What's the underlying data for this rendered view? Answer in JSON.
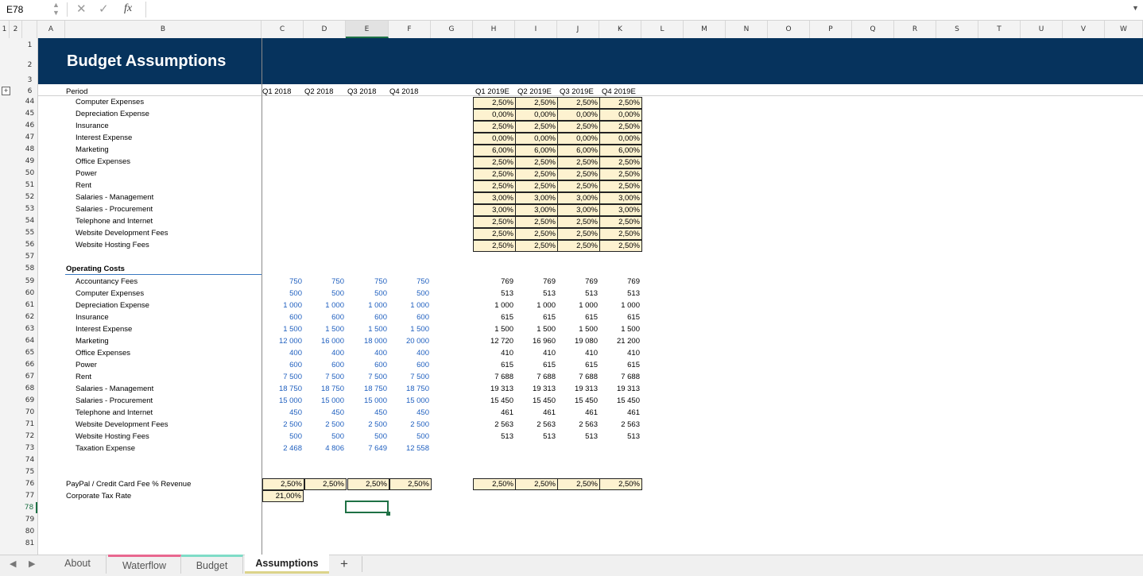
{
  "formula_bar": {
    "name_box": "E78",
    "fx_label": "fx",
    "formula": ""
  },
  "outline_levels": [
    "1",
    "2"
  ],
  "columns": [
    "A",
    "B",
    "C",
    "D",
    "E",
    "F",
    "G",
    "H",
    "I",
    "J",
    "K",
    "L",
    "M",
    "N",
    "O",
    "P",
    "Q",
    "R",
    "S",
    "T",
    "U",
    "V",
    "W"
  ],
  "rows": [
    "1",
    "2",
    "3",
    "6",
    "44",
    "45",
    "46",
    "47",
    "48",
    "49",
    "50",
    "51",
    "52",
    "53",
    "54",
    "55",
    "56",
    "57",
    "58",
    "59",
    "60",
    "61",
    "62",
    "63",
    "64",
    "65",
    "66",
    "67",
    "68",
    "69",
    "70",
    "71",
    "72",
    "73",
    "74",
    "75",
    "76",
    "77",
    "78",
    "79",
    "80",
    "81"
  ],
  "title": "Budget Assumptions",
  "period_label": "Period",
  "periods_2018": [
    "Q1 2018",
    "Q2 2018",
    "Q3 2018",
    "Q4 2018"
  ],
  "periods_2019": [
    "Q1 2019E",
    "Q2 2019E",
    "Q3 2019E",
    "Q4 2019E"
  ],
  "growth_labels": [
    "Computer Expenses",
    "Depreciation Expense",
    "Insurance",
    "Interest Expense",
    "Marketing",
    "Office Expenses",
    "Power",
    "Rent",
    "Salaries - Management",
    "Salaries - Procurement",
    "Telephone and Internet",
    "Website Development Fees",
    "Website Hosting Fees"
  ],
  "growth_rates": [
    "2,50%",
    "0,00%",
    "2,50%",
    "0,00%",
    "6,00%",
    "2,50%",
    "2,50%",
    "2,50%",
    "3,00%",
    "3,00%",
    "2,50%",
    "2,50%",
    "2,50%"
  ],
  "operating_title": "Operating Costs",
  "operating": [
    {
      "label": "Accountancy Fees",
      "q2018": [
        "750",
        "750",
        "750",
        "750"
      ],
      "q2019": [
        "769",
        "769",
        "769",
        "769"
      ]
    },
    {
      "label": "Computer Expenses",
      "q2018": [
        "500",
        "500",
        "500",
        "500"
      ],
      "q2019": [
        "513",
        "513",
        "513",
        "513"
      ]
    },
    {
      "label": "Depreciation Expense",
      "q2018": [
        "1 000",
        "1 000",
        "1 000",
        "1 000"
      ],
      "q2019": [
        "1 000",
        "1 000",
        "1 000",
        "1 000"
      ]
    },
    {
      "label": "Insurance",
      "q2018": [
        "600",
        "600",
        "600",
        "600"
      ],
      "q2019": [
        "615",
        "615",
        "615",
        "615"
      ]
    },
    {
      "label": "Interest Expense",
      "q2018": [
        "1 500",
        "1 500",
        "1 500",
        "1 500"
      ],
      "q2019": [
        "1 500",
        "1 500",
        "1 500",
        "1 500"
      ]
    },
    {
      "label": "Marketing",
      "q2018": [
        "12 000",
        "16 000",
        "18 000",
        "20 000"
      ],
      "q2019": [
        "12 720",
        "16 960",
        "19 080",
        "21 200"
      ]
    },
    {
      "label": "Office Expenses",
      "q2018": [
        "400",
        "400",
        "400",
        "400"
      ],
      "q2019": [
        "410",
        "410",
        "410",
        "410"
      ]
    },
    {
      "label": "Power",
      "q2018": [
        "600",
        "600",
        "600",
        "600"
      ],
      "q2019": [
        "615",
        "615",
        "615",
        "615"
      ]
    },
    {
      "label": "Rent",
      "q2018": [
        "7 500",
        "7 500",
        "7 500",
        "7 500"
      ],
      "q2019": [
        "7 688",
        "7 688",
        "7 688",
        "7 688"
      ]
    },
    {
      "label": "Salaries - Management",
      "q2018": [
        "18 750",
        "18 750",
        "18 750",
        "18 750"
      ],
      "q2019": [
        "19 313",
        "19 313",
        "19 313",
        "19 313"
      ]
    },
    {
      "label": "Salaries - Procurement",
      "q2018": [
        "15 000",
        "15 000",
        "15 000",
        "15 000"
      ],
      "q2019": [
        "15 450",
        "15 450",
        "15 450",
        "15 450"
      ]
    },
    {
      "label": "Telephone and Internet",
      "q2018": [
        "450",
        "450",
        "450",
        "450"
      ],
      "q2019": [
        "461",
        "461",
        "461",
        "461"
      ]
    },
    {
      "label": "Website Development Fees",
      "q2018": [
        "2 500",
        "2 500",
        "2 500",
        "2 500"
      ],
      "q2019": [
        "2 563",
        "2 563",
        "2 563",
        "2 563"
      ]
    },
    {
      "label": "Website Hosting Fees",
      "q2018": [
        "500",
        "500",
        "500",
        "500"
      ],
      "q2019": [
        "513",
        "513",
        "513",
        "513"
      ]
    },
    {
      "label": "Taxation Expense",
      "q2018": [
        "2 468",
        "4 806",
        "7 649",
        "12 558"
      ],
      "q2019": [
        "",
        "",
        "",
        ""
      ]
    }
  ],
  "paypal_label": "PayPal / Credit Card Fee % Revenue",
  "paypal_2018": [
    "2,50%",
    "2,50%",
    "2,50%",
    "2,50%"
  ],
  "paypal_2019": [
    "2,50%",
    "2,50%",
    "2,50%",
    "2,50%"
  ],
  "tax_label": "Corporate Tax Rate",
  "tax_rate": "21,00%",
  "sheet_tabs": [
    "About",
    "Waterflow",
    "Budget",
    "Assumptions"
  ],
  "active_tab": "Assumptions",
  "add_sheet": "+",
  "colors": {
    "banner": "#06335d",
    "input_blue": "#1f5fbf",
    "pct_fill": "#fdf2d0",
    "selection": "#1e7145",
    "waterflow_tab": "#e8678f",
    "budget_tab": "#7fdcc7"
  }
}
